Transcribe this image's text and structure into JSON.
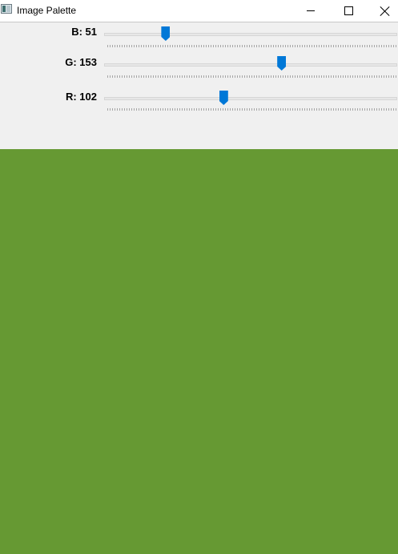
{
  "window": {
    "title": "Image Palette",
    "icon": "app-window-icon",
    "buttons": [
      "minimize-icon",
      "maximize-icon",
      "close-icon"
    ]
  },
  "sliders": [
    {
      "channel": "B",
      "label": "B: 51",
      "value": 51,
      "min": 0,
      "max": 255
    },
    {
      "channel": "G",
      "label": "G: 153",
      "value": 153,
      "min": 0,
      "max": 255
    },
    {
      "channel": "R",
      "label": "R: 102",
      "value": 102,
      "min": 0,
      "max": 255
    }
  ],
  "colors": {
    "preview": "#669933",
    "panel_background": "#f0f0f0",
    "accent": "#0078d7"
  }
}
